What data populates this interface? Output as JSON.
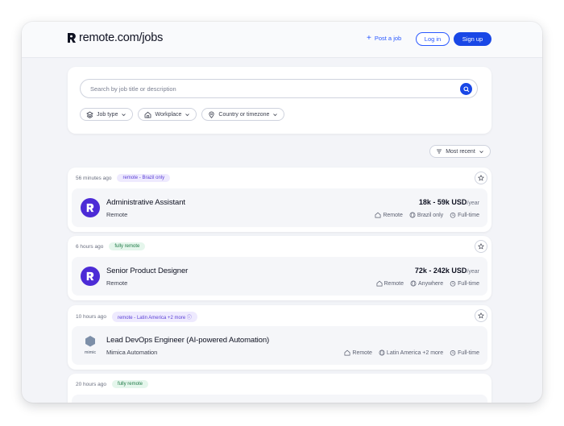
{
  "header": {
    "logo_text": "remote.com/jobs",
    "post_job": "Post a job",
    "login": "Log in",
    "signup": "Sign up"
  },
  "search": {
    "placeholder": "Search by job title or description",
    "filters": [
      "Job type",
      "Workplace",
      "Country or timezone"
    ]
  },
  "sort": {
    "label": "Most recent"
  },
  "jobs": [
    {
      "time": "56 minutes ago",
      "badge": "remote - Brazil only",
      "badge_color": "purple",
      "title": "Administrative Assistant",
      "company": "Remote",
      "salary": "18k - 59k USD",
      "salary_period": "/year",
      "tags": [
        "Remote",
        "Brazil only",
        "Full-time"
      ]
    },
    {
      "time": "6 hours ago",
      "badge": "fully remote",
      "badge_color": "green",
      "title": "Senior Product Designer",
      "company": "Remote",
      "salary": "72k - 242k USD",
      "salary_period": "/year",
      "tags": [
        "Remote",
        "Anywhere",
        "Full-time"
      ]
    },
    {
      "time": "10 hours ago",
      "badge": "remote - Latin America +2 more",
      "badge_color": "purple",
      "title": "Lead DevOps Engineer (AI-powered Automation)",
      "company": "Mimica Automation",
      "logo_text": "mimic",
      "tags": [
        "Remote",
        "Latin America +2 more",
        "Full-time"
      ]
    },
    {
      "time": "20 hours ago",
      "badge": "fully remote",
      "badge_color": "green"
    }
  ],
  "colors": {
    "accent": "#1947e6",
    "avatar": "#4c2bd6",
    "background": "#f3f4f8"
  }
}
